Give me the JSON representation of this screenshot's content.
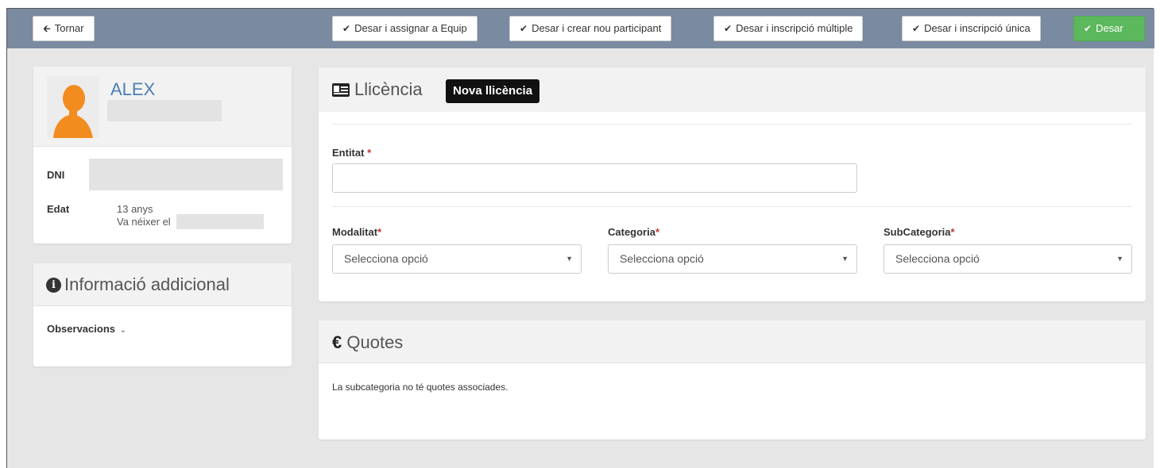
{
  "toolbar": {
    "back_label": "Tornar",
    "btn_team": "Desar i assignar a Equip",
    "btn_new_participant": "Desar i crear nou participant",
    "btn_multi": "Desar i inscripció múltiple",
    "btn_single": "Desar i inscripció única",
    "btn_save": "Desar"
  },
  "profile": {
    "name": "ALEX",
    "dni_label": "DNI",
    "age_label": "Edat",
    "age_value": "13 anys",
    "birth_prefix": "Va néixer el"
  },
  "additional": {
    "title": "Informació addicional",
    "observations_label": "Observacions"
  },
  "license": {
    "title": "Llicència",
    "badge": "Nova llicència",
    "entity_label": "Entitat",
    "required_mark": "*",
    "modality_label": "Modalitat",
    "category_label": "Categoria",
    "subcategory_label": "SubCategoria",
    "select_placeholder": "Selecciona opció"
  },
  "fees": {
    "title": "Quotes",
    "empty_message": "La subcategoria no té quotes associades."
  },
  "colors": {
    "topbar": "#7a8aa0",
    "save_button": "#5cb85c",
    "name": "#4a7fb5",
    "required": "#c0392b"
  }
}
